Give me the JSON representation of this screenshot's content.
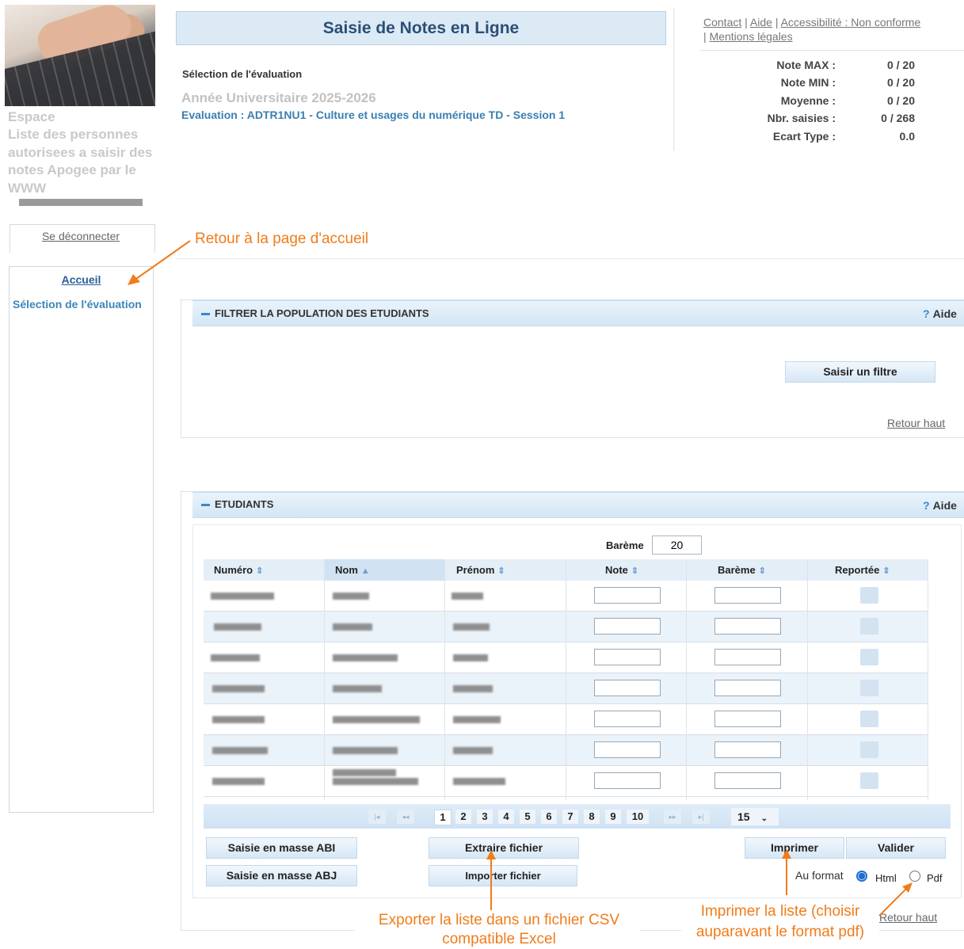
{
  "left": {
    "title": "Espace\nListe des personnes autorisees a saisir des notes Apogee par le WWW",
    "logout": "Se déconnecter",
    "nav_home": "Accueil",
    "nav_selection": "Sélection de l'évaluation"
  },
  "header": {
    "title": "Saisie de Notes en Ligne",
    "selection_label": "Sélection de l'évaluation",
    "year": "Année Universitaire 2025-2026",
    "evaluation": "Evaluation : ADTR1NU1 - Culture et usages du numérique TD - Session 1"
  },
  "toplinks": {
    "contact": "Contact",
    "aide": "Aide",
    "access": "Accessibilité : Non conforme",
    "mentions": "Mentions légales",
    "sep": "|"
  },
  "stats": [
    {
      "label": "Note MAX :",
      "value": "0 / 20"
    },
    {
      "label": "Note MIN :",
      "value": "0 / 20"
    },
    {
      "label": "Moyenne :",
      "value": "0 / 20"
    },
    {
      "label": "Nbr. saisies :",
      "value": "0 / 268"
    },
    {
      "label": "Ecart Type :",
      "value": "0.0"
    }
  ],
  "filter": {
    "title": "FILTRER LA POPULATION DES ETUDIANTS",
    "aide": "Aide",
    "button": "Saisir un filtre",
    "retour": "Retour haut"
  },
  "students": {
    "title": "ETUDIANTS",
    "aide": "Aide",
    "bareme_label": "Barème",
    "bareme_value": "20",
    "columns": [
      "Numéro",
      "Nom",
      "Prénom",
      "Note",
      "Barème",
      "Reportée"
    ],
    "pages": [
      "1",
      "2",
      "3",
      "4",
      "5",
      "6",
      "7",
      "8",
      "9",
      "10"
    ],
    "current_page": "1",
    "page_size": "15",
    "buttons": {
      "abi": "Saisie en masse ABI",
      "abj": "Saisie en masse ABJ",
      "extract": "Extraire fichier",
      "import": "Importer fichier",
      "print": "Imprimer",
      "validate": "Valider"
    },
    "format_label": "Au format",
    "format_html": "Html",
    "format_pdf": "Pdf",
    "format_selected": "Html",
    "retour": "Retour haut"
  },
  "annotations": {
    "home": "Retour à la page d'accueil",
    "export": "Exporter la liste dans un fichier CSV compatible Excel",
    "print": "Imprimer la liste (choisir auparavant le format pdf)"
  },
  "colors": {
    "accent_orange": "#f07c1a",
    "header_blue": "#2b4f76",
    "link_blue": "#3a7fb0"
  }
}
